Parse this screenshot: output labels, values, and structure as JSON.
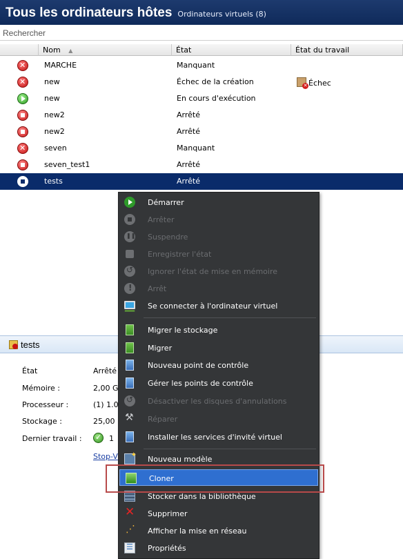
{
  "header": {
    "title": "Tous les ordinateurs hôtes",
    "subtitle": "Ordinateurs virtuels (8)"
  },
  "search": {
    "placeholder": "Rechercher"
  },
  "columns": {
    "name": "Nom",
    "sort_indicator": "▲",
    "state": "État",
    "job_state": "État du travail"
  },
  "rows": [
    {
      "status_icon": "error-icon",
      "name": "MARCHE",
      "state": "Manquant",
      "job": ""
    },
    {
      "status_icon": "error-icon",
      "name": "new",
      "state": "Échec de la création",
      "job": "Échec",
      "job_icon": "job-failed-icon"
    },
    {
      "status_icon": "running-icon",
      "name": "new",
      "state": "En cours d'exécution",
      "job": ""
    },
    {
      "status_icon": "stopped-icon",
      "name": "new2",
      "state": "Arrêté",
      "job": ""
    },
    {
      "status_icon": "stopped-icon",
      "name": "new2",
      "state": "Arrêté",
      "job": ""
    },
    {
      "status_icon": "error-icon",
      "name": "seven",
      "state": "Manquant",
      "job": ""
    },
    {
      "status_icon": "stopped-icon",
      "name": "seven_test1",
      "state": "Arrêté",
      "job": ""
    },
    {
      "status_icon": "stopped-icon",
      "name": "tests",
      "state": "Arrêté",
      "job": "",
      "selected": true
    }
  ],
  "details": {
    "title": "tests",
    "labels": {
      "state": "État",
      "memory": "Mémoire :",
      "processor": "Processeur :",
      "storage": "Stockage :",
      "last_job": "Dernier travail :"
    },
    "values": {
      "state": "Arrêté",
      "memory": "2,00 G",
      "processor": "(1) 1.0",
      "storage": "25,00",
      "last_job": "1"
    },
    "link": "Stop-V"
  },
  "context_menu": {
    "items": [
      {
        "label": "Démarrer",
        "icon": "start-icon",
        "enabled": true
      },
      {
        "label": "Arrêter",
        "icon": "stop-icon",
        "enabled": false
      },
      {
        "label": "Suspendre",
        "icon": "pause-icon",
        "enabled": false
      },
      {
        "label": "Enregistrer l'état",
        "icon": "save-state-icon",
        "enabled": false
      },
      {
        "label": "Ignorer l'état de mise en mémoire",
        "icon": "discard-state-icon",
        "enabled": false
      },
      {
        "label": "Arrêt",
        "icon": "shutdown-icon",
        "enabled": false
      },
      {
        "label": "Se connecter à l'ordinateur virtuel",
        "icon": "connect-icon",
        "enabled": true
      },
      {
        "label": "Migrer le stockage",
        "icon": "migrate-storage-icon",
        "enabled": true
      },
      {
        "label": "Migrer",
        "icon": "migrate-icon",
        "enabled": true
      },
      {
        "label": "Nouveau point de contrôle",
        "icon": "new-checkpoint-icon",
        "enabled": true
      },
      {
        "label": "Gérer les points de contrôle",
        "icon": "manage-checkpoints-icon",
        "enabled": true
      },
      {
        "label": "Désactiver les disques d'annulations",
        "icon": "disable-undo-disks-icon",
        "enabled": false
      },
      {
        "label": "Réparer",
        "icon": "repair-icon",
        "enabled": false
      },
      {
        "label": "Installer les services d'invité virtuel",
        "icon": "install-guest-services-icon",
        "enabled": true
      },
      {
        "label": "Nouveau modèle",
        "icon": "new-template-icon",
        "enabled": true
      },
      {
        "label": "Cloner",
        "icon": "clone-icon",
        "enabled": true,
        "highlighted": true
      },
      {
        "label": "Stocker dans la bibliothèque",
        "icon": "library-icon",
        "enabled": true
      },
      {
        "label": "Supprimer",
        "icon": "delete-icon",
        "enabled": true
      },
      {
        "label": "Afficher la mise en réseau",
        "icon": "network-icon",
        "enabled": true
      },
      {
        "label": "Propriétés",
        "icon": "properties-icon",
        "enabled": true
      }
    ]
  },
  "colors": {
    "header_bg": "#0f2a5a",
    "selection_bg": "#0a2b6a",
    "menu_bg": "#343638",
    "menu_highlight": "#2f6fd0",
    "annotation_box": "#b84a4a"
  }
}
